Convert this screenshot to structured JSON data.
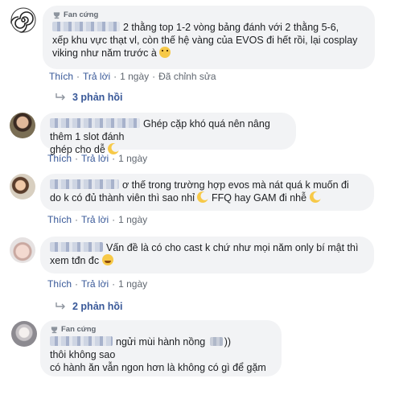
{
  "comments": [
    {
      "badge": "Fan cứng",
      "text_a": "2 thằng top 1-2 vòng bảng đánh với 2 thằng 5-6,",
      "text_b": "xếp khu vực thạt vl, còn thế hệ vàng của EVOS đi hết rồi, lại cosplay",
      "text_c": "viking như năm trước à",
      "emoji": "thinking",
      "actions": {
        "like": "Thích",
        "reply": "Trả lời",
        "time": "1 ngày",
        "edited": "Đã chỉnh sửa"
      },
      "replies_label": "3 phản hồi"
    },
    {
      "text_a": "Ghép cặp khó quá nên nâng thêm 1 slot đánh",
      "text_b": "ghép cho dễ",
      "emoji": "crescent-moon",
      "actions": {
        "like": "Thích",
        "reply": "Trả lời",
        "time": "1 ngày"
      }
    },
    {
      "text_a": "ơ thế trong trường hợp evos mà nát quá k muốn đi",
      "text_b": "do k có đủ thành viên thì sao nhỉ",
      "text_c": "FFQ hay GAM đi nhễ",
      "emoji": "crescent-moon",
      "actions": {
        "like": "Thích",
        "reply": "Trả lời",
        "time": "1 ngày"
      }
    },
    {
      "text_a": "Vấn đề là có cho cast k chứ như mọi năm only bí mật thì",
      "text_b": "xem tđn đc",
      "emoji": "grinning",
      "actions": {
        "like": "Thích",
        "reply": "Trả lời",
        "time": "1 ngày"
      },
      "replies_label": "2 phản hồi"
    },
    {
      "badge": "Fan cứng",
      "text_a": "ngửi mùi hành nồng",
      "text_a_end": "))",
      "text_b": "thôi không sao",
      "text_c": "có hành ăn vẫn ngon hơn là không có gì để gặm"
    }
  ],
  "colors": {
    "bubble": "#f2f3f5",
    "link": "#385898",
    "meta": "#606770",
    "text": "#1c1e21"
  }
}
